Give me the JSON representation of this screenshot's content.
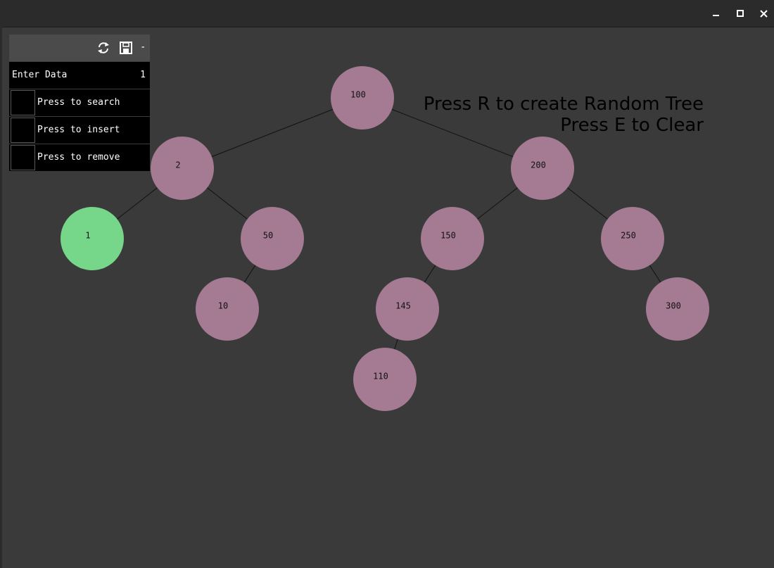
{
  "window": {
    "controls": {
      "minimize": "minimize-icon",
      "maximize": "maximize-icon",
      "close": "close-icon"
    }
  },
  "panel": {
    "icons": [
      "refresh-icon",
      "save-icon",
      "collapse-icon"
    ],
    "collapse_symbol": "-",
    "data_label": "Enter Data",
    "data_value": "1",
    "search_label": "Press to search",
    "insert_label": "Press to insert",
    "remove_label": "Press to remove"
  },
  "instructions": {
    "line1": "Press R to create Random Tree",
    "line2": "Press E to Clear"
  },
  "colors": {
    "background": "#3a3a3a",
    "node": "#a57a93",
    "highlight_node": "#76d68a",
    "edge": "#111111",
    "panel_bg": "#000000",
    "panel_header": "#4b4b4b"
  },
  "tree": {
    "root": "100",
    "highlighted": "1",
    "nodes": [
      {
        "value": "100",
        "left": "2",
        "right": "200"
      },
      {
        "value": "2",
        "left": "1",
        "right": "50"
      },
      {
        "value": "200",
        "left": "150",
        "right": "250"
      },
      {
        "value": "1",
        "left": null,
        "right": null
      },
      {
        "value": "50",
        "left": "10",
        "right": null
      },
      {
        "value": "150",
        "left": "145",
        "right": null
      },
      {
        "value": "250",
        "left": null,
        "right": "300"
      },
      {
        "value": "10",
        "left": null,
        "right": null
      },
      {
        "value": "145",
        "left": "110",
        "right": null
      },
      {
        "value": "300",
        "left": null,
        "right": null
      },
      {
        "value": "110",
        "left": null,
        "right": null
      }
    ]
  }
}
